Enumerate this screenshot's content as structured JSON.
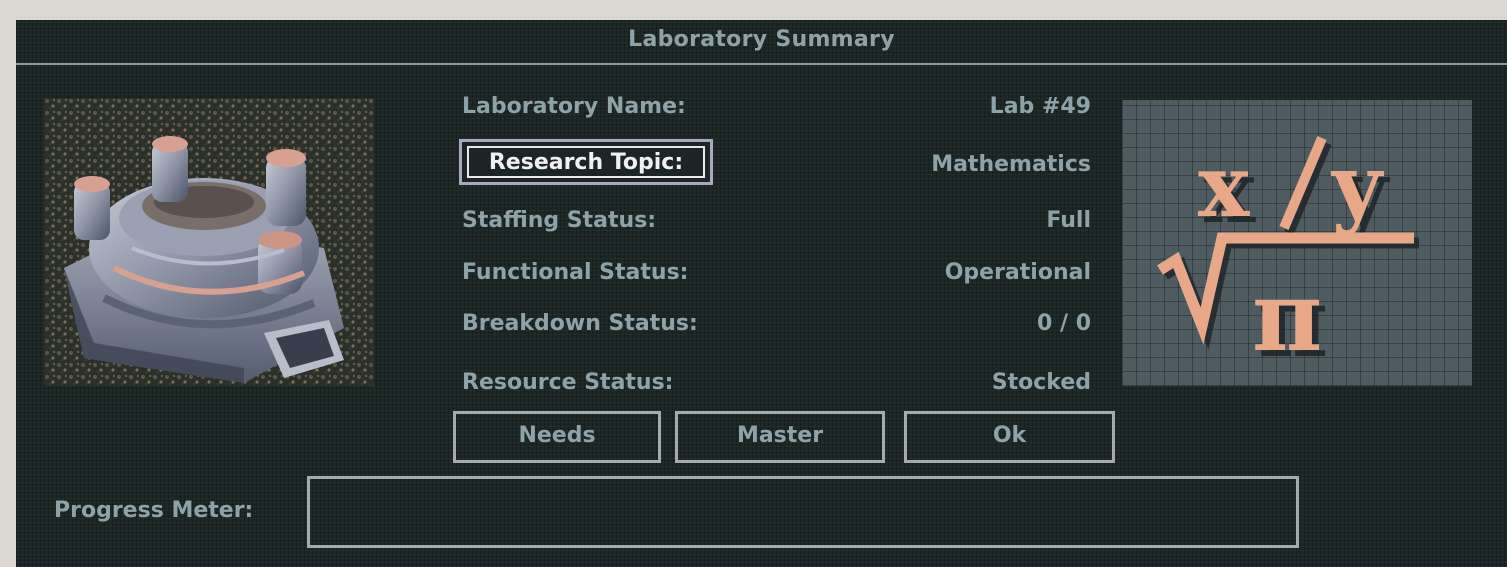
{
  "dialog": {
    "title": "Laboratory Summary"
  },
  "fields": {
    "name": {
      "label": "Laboratory Name:",
      "value": "Lab #49"
    },
    "topic": {
      "label": "Research Topic:",
      "value": "Mathematics"
    },
    "staffing": {
      "label": "Staffing Status:",
      "value": "Full"
    },
    "functional": {
      "label": "Functional Status:",
      "value": "Operational"
    },
    "breakdown": {
      "label": "Breakdown Status:",
      "value": "0 / 0"
    },
    "resource": {
      "label": "Resource Status:",
      "value": "Stocked"
    }
  },
  "buttons": {
    "needs": "Needs",
    "master": "Master",
    "ok": "Ok"
  },
  "progress": {
    "label": "Progress Meter:",
    "fraction": 0
  },
  "research_image": {
    "numerator": "x",
    "slash": "/",
    "denominator_top": "y",
    "radicand": "π"
  },
  "colors": {
    "panel_bg": "#1b2625",
    "text": "#8ea3a8",
    "highlight_text": "#f0f0f4",
    "border": "#a6aab0",
    "formula": "#e8a888"
  }
}
